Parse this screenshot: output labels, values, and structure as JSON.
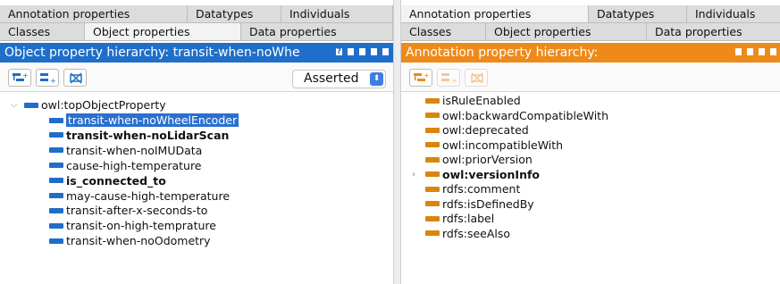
{
  "left": {
    "tabs_row1": [
      "Annotation properties",
      "Datatypes",
      "Individuals"
    ],
    "tabs_row2": [
      "Classes",
      "Object properties",
      "Data properties"
    ],
    "selected_tab": "Object properties",
    "title": "Object property hierarchy: transit-when-noWhe",
    "dropdown_value": "Asserted",
    "root": "owl:topObjectProperty",
    "items": [
      {
        "label": "transit-when-noWheelEncoder",
        "bold": false,
        "selected": true
      },
      {
        "label": "transit-when-noLidarScan",
        "bold": true,
        "selected": false
      },
      {
        "label": "transit-when-noIMUData",
        "bold": false,
        "selected": false
      },
      {
        "label": "cause-high-temperature",
        "bold": false,
        "selected": false
      },
      {
        "label": "is_connected_to",
        "bold": true,
        "selected": false
      },
      {
        "label": "may-cause-high-temperature",
        "bold": false,
        "selected": false
      },
      {
        "label": "transit-after-x-seconds-to",
        "bold": false,
        "selected": false
      },
      {
        "label": "transit-on-high-temprature",
        "bold": false,
        "selected": false
      },
      {
        "label": "transit-when-noOdometry",
        "bold": false,
        "selected": false
      }
    ]
  },
  "right": {
    "tabs_row1": [
      "Annotation properties",
      "Datatypes",
      "Individuals"
    ],
    "tabs_row2": [
      "Classes",
      "Object properties",
      "Data properties"
    ],
    "selected_tab": "Annotation properties",
    "title": "Annotation property hierarchy:",
    "items": [
      {
        "label": "isRuleEnabled",
        "bold": false
      },
      {
        "label": "owl:backwardCompatibleWith",
        "bold": false
      },
      {
        "label": "owl:deprecated",
        "bold": false
      },
      {
        "label": "owl:incompatibleWith",
        "bold": false
      },
      {
        "label": "owl:priorVersion",
        "bold": false
      },
      {
        "label": "owl:versionInfo",
        "bold": true,
        "expandable": true
      },
      {
        "label": "rdfs:comment",
        "bold": false
      },
      {
        "label": "rdfs:isDefinedBy",
        "bold": false
      },
      {
        "label": "rdfs:label",
        "bold": false
      },
      {
        "label": "rdfs:seeAlso",
        "bold": false
      }
    ]
  },
  "colors": {
    "object_accent": "#1f6ec9",
    "annotation_accent": "#ee8a1a"
  }
}
